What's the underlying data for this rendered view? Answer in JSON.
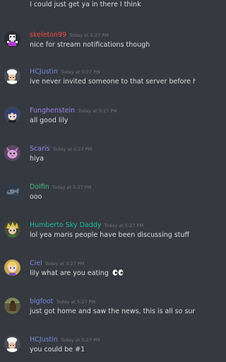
{
  "chat": {
    "continuation_text": "I could just get ya in there I think",
    "messages": [
      {
        "username": "skeleton99",
        "name_color": "#f04747",
        "timestamp": "Today at 5:27 PM",
        "text": "nice for stream notifications though",
        "avatar_icon": "pixel-skeleton-avatar",
        "avatar_bg": "#2b2b33"
      },
      {
        "username": "HCJustin",
        "name_color": "#7289da",
        "timestamp": "Today at 5:27 PM",
        "text": "ive never invited someone to that server before haha",
        "avatar_icon": "chef-avatar",
        "avatar_bg": "#4a4d55"
      },
      {
        "username": "Funghenstein",
        "name_color": "#9b84ee",
        "timestamp": "Today at 5:27 PM",
        "text": "all good lily",
        "avatar_icon": "anime-blue-hair-avatar",
        "avatar_bg": "#3a4660"
      },
      {
        "username": "Scaris",
        "name_color": "#9b84ee",
        "timestamp": "Today at 5:27 PM",
        "text": "hiya",
        "avatar_icon": "pink-creature-avatar",
        "avatar_bg": "#5a4663"
      },
      {
        "username": "Dolfin",
        "name_color": "#43b581",
        "timestamp": "Today at 5:27 PM",
        "text": "ooo",
        "avatar_icon": "fish-avatar",
        "avatar_bg": "#2f3a4a"
      },
      {
        "username": "Humberto Sky Daddy",
        "name_color": "#1abc9c",
        "timestamp": "Today at 5:27 PM",
        "text": "lol yea maris people have been discussing stuff",
        "avatar_icon": "anime-character-avatar",
        "avatar_bg": "#4a4a3a"
      },
      {
        "username": "Ciel",
        "name_color": "#7289da",
        "timestamp": "Today at 5:27 PM",
        "text": "lily what are you eating",
        "emoji": "eyes-emoji",
        "avatar_icon": "blonde-anime-avatar",
        "avatar_bg": "#c9a85a"
      },
      {
        "username": "bigfoot",
        "name_color": "#7289da",
        "timestamp": "Today at 5:27 PM",
        "text": "just got home and saw the news, this is all so surreal for",
        "avatar_icon": "bigfoot-avatar",
        "avatar_bg": "#5b5a3e"
      },
      {
        "username": "HCJustin",
        "name_color": "#7289da",
        "timestamp": "Today at 5:27 PM",
        "text": "you could be #1",
        "avatar_icon": "chef-avatar",
        "avatar_bg": "#4a4d55"
      }
    ]
  }
}
